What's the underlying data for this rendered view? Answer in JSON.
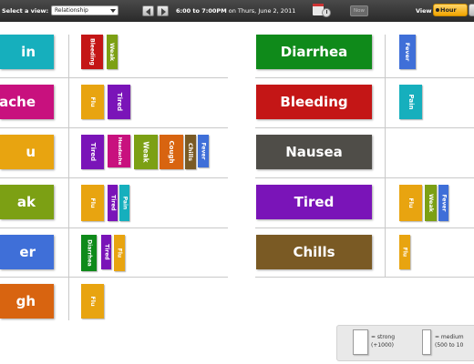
{
  "toolbar": {
    "view_label": "Select a view:",
    "view_selected": "Relationship",
    "time_from": "6:00 to 7:00PM",
    "time_on": "on Thurs, June 2, 2011",
    "now_label": "Now",
    "viewby_label": "View by:",
    "hour_label": "Hour"
  },
  "colors": {
    "cyan": "#16afbd",
    "magenta": "#c8117e",
    "gold": "#e8a410",
    "olive": "#7ca014",
    "blue": "#3f6fd8",
    "orange": "#d86410",
    "red": "#c41616",
    "purple": "#7a14b8",
    "green": "#0f8a1a",
    "dark_gray": "#4f4d48",
    "brown": "#7a5a24"
  },
  "left_rows": [
    {
      "symptom": "in",
      "color": "cyan",
      "related": [
        {
          "label": "Bleeding",
          "color": "red"
        },
        {
          "label": "Weak",
          "color": "olive"
        }
      ]
    },
    {
      "symptom": "ache",
      "color": "magenta",
      "related": [
        {
          "label": "Flu",
          "color": "gold"
        },
        {
          "label": "Tired",
          "color": "purple"
        }
      ]
    },
    {
      "symptom": "u",
      "color": "gold",
      "related": [
        {
          "label": "Tired",
          "color": "purple"
        },
        {
          "label": "Headache",
          "color": "magenta"
        },
        {
          "label": "Weak",
          "color": "olive"
        },
        {
          "label": "Cough",
          "color": "orange"
        },
        {
          "label": "Chills",
          "color": "brown"
        },
        {
          "label": "Fever",
          "color": "blue"
        }
      ]
    },
    {
      "symptom": "ak",
      "color": "olive",
      "related": [
        {
          "label": "Flu",
          "color": "gold"
        },
        {
          "label": "Tired",
          "color": "purple"
        },
        {
          "label": "Pain",
          "color": "cyan"
        }
      ]
    },
    {
      "symptom": "er",
      "color": "blue",
      "related": [
        {
          "label": "Diarrhea",
          "color": "green"
        },
        {
          "label": "Tired",
          "color": "purple"
        },
        {
          "label": "Flu",
          "color": "gold"
        }
      ]
    },
    {
      "symptom": "gh",
      "color": "orange",
      "related": [
        {
          "label": "Flu",
          "color": "gold"
        }
      ]
    }
  ],
  "right_rows": [
    {
      "symptom": "Diarrhea",
      "color": "green",
      "related": [
        {
          "label": "Fever",
          "color": "blue"
        }
      ]
    },
    {
      "symptom": "Bleeding",
      "color": "red",
      "related": [
        {
          "label": "Pain",
          "color": "cyan"
        }
      ]
    },
    {
      "symptom": "Nausea",
      "color": "dark_gray",
      "related": []
    },
    {
      "symptom": "Tired",
      "color": "purple",
      "related": [
        {
          "label": "Flu",
          "color": "gold"
        },
        {
          "label": "Weak",
          "color": "olive"
        },
        {
          "label": "Fever",
          "color": "blue"
        }
      ]
    },
    {
      "symptom": "Chills",
      "color": "brown",
      "related": [
        {
          "label": "Flu",
          "color": "gold"
        }
      ]
    }
  ],
  "legend": {
    "strong_label": "= strong",
    "strong_range": "(+1000)",
    "medium_label": "= medium",
    "medium_range": "(500 to 10"
  }
}
